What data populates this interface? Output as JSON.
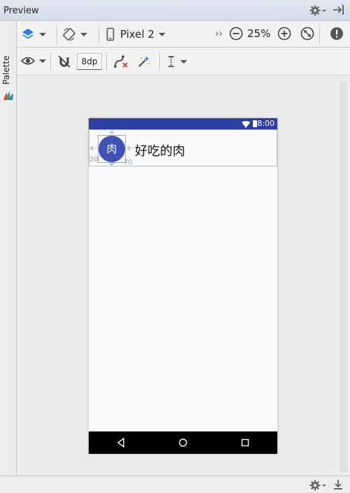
{
  "panel": {
    "title": "Preview",
    "side_tab": "Palette"
  },
  "toolbar": {
    "design_mode": "layers",
    "orientation": "rotate",
    "device": "Pixel 2",
    "overflow": "››",
    "zoom": "25%",
    "default_margin": "8dp"
  },
  "phone": {
    "status_time": "8:00",
    "item": {
      "avatar_text": "肉",
      "title": "好吃的肉"
    },
    "constraint_left": "20",
    "constraint_right": "70"
  },
  "colors": {
    "primary": "#3f51b5",
    "primary_dark": "#303f9f",
    "layers_icon": "#2f7ed8",
    "error": "#c83c3c"
  }
}
